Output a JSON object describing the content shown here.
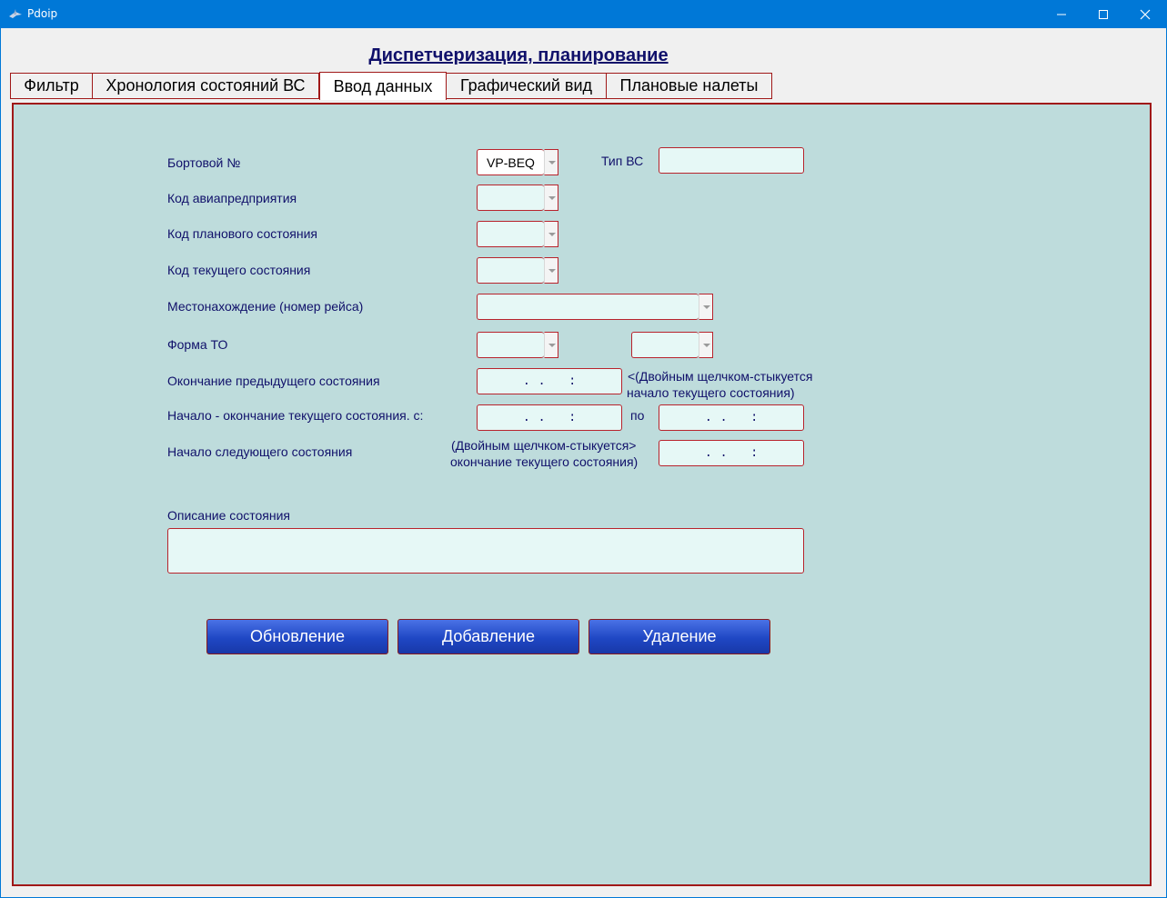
{
  "window": {
    "title": "Pdoip"
  },
  "page_title": "Диспетчеризация, планирование",
  "tabs": [
    {
      "label": "Фильтр"
    },
    {
      "label": "Хронология состояний ВС"
    },
    {
      "label": "Ввод данных",
      "active": true
    },
    {
      "label": "Графический вид"
    },
    {
      "label": "Плановые налеты"
    }
  ],
  "form": {
    "board_number": {
      "label": "Бортовой №",
      "value": "VP-BEQ"
    },
    "aircraft_type": {
      "label": "Тип ВС",
      "value": ""
    },
    "airline_code": {
      "label": "Код авиапредприятия",
      "value": ""
    },
    "planned_state_code": {
      "label": "Код планового состояния",
      "value": ""
    },
    "current_state_code": {
      "label": "Код текущего состояния",
      "value": ""
    },
    "location": {
      "label": "Местонахождение (номер рейса)",
      "value": ""
    },
    "maintenance_form": {
      "label": "Форма ТО",
      "value1": "",
      "value2": ""
    },
    "prev_state_end": {
      "label": "Окончание предыдущего состояния",
      "mask": ". .   :",
      "hint_line1": "<(Двойным щелчком-стыкуется",
      "hint_line2": "начало текущего состояния)"
    },
    "current_state_range": {
      "label": "Начало - окончание текущего состояния. с:",
      "mask_from": ". .   :",
      "to_label": "по",
      "mask_to": ". .   :"
    },
    "next_state_start": {
      "label": "Начало следующего состояния",
      "hint_line1": "(Двойным щелчком-стыкуется>",
      "hint_line2": "окончание текущего состояния)",
      "mask": ". .   :"
    },
    "description": {
      "label": "Описание состояния",
      "value": ""
    }
  },
  "buttons": {
    "update": "Обновление",
    "add": "Добавление",
    "delete": "Удаление"
  },
  "colors": {
    "titlebar": "#0078d7",
    "panel_bg": "#bedcdc",
    "field_bg": "#e6f8f6",
    "border_accent": "#b8232c",
    "label_text": "#10106a",
    "button_blue": "#2a52d0"
  }
}
